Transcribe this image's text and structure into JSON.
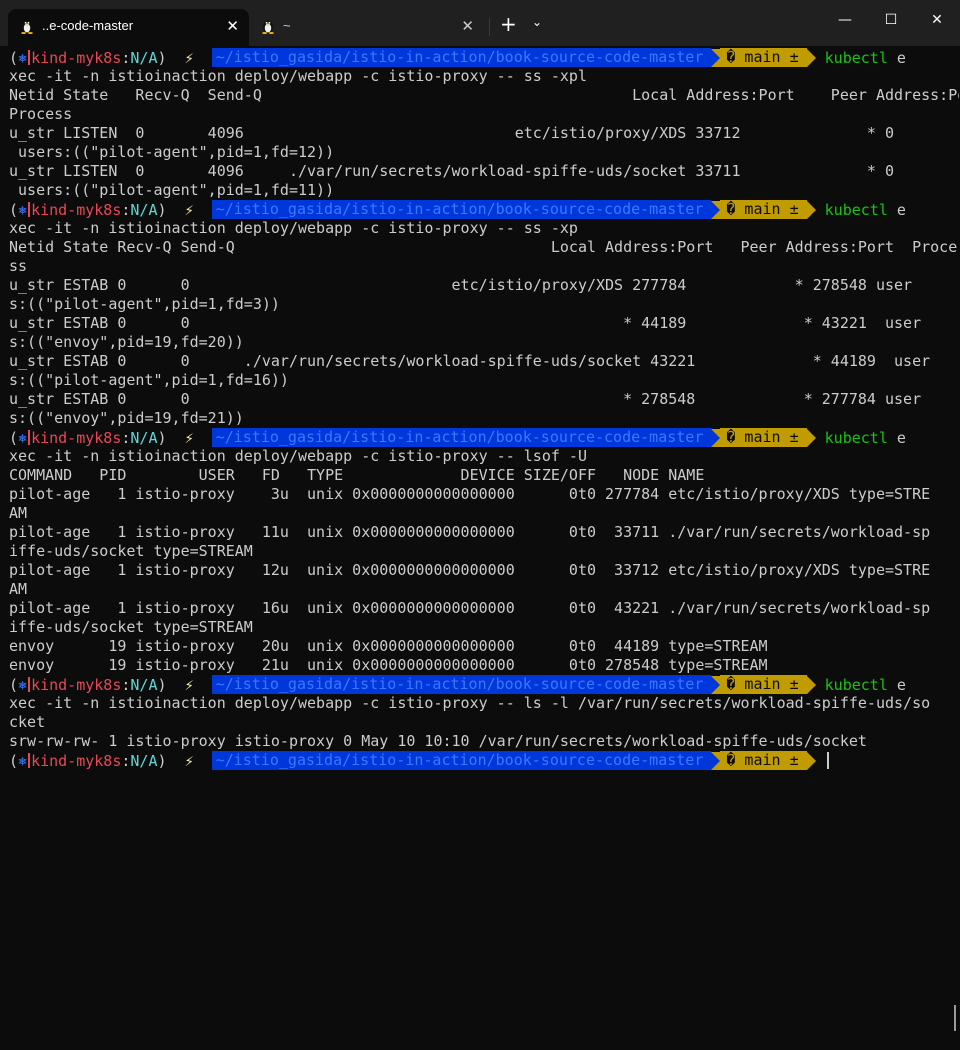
{
  "window": {
    "tabs": [
      {
        "title": "..e-code-master",
        "close": "✕"
      },
      {
        "title": "~",
        "close": "✕"
      }
    ],
    "new_tab": "+",
    "dropdown": "⌄",
    "minimize": "—",
    "maximize": "☐",
    "close": "✕"
  },
  "prompt": {
    "open_paren": "(",
    "k8s_icon": "⎈",
    "context": "kind-myk8s",
    "colon": ":",
    "namespace": "N/A",
    "close_paren": ")",
    "bolt": "⚡",
    "directory": "~/istio_gasida/istio-in-action/book-source-code-master",
    "git": "� main ±",
    "cmd_word": "kubectl"
  },
  "blocks": [
    {
      "cmd_rest": " e",
      "output": [
        "xec -it -n istioinaction deploy/webapp -c istio-proxy -- ss -xpl",
        "Netid State   Recv-Q  Send-Q                                         Local Address:Port    Peer Address:Port",
        "Process",
        "u_str LISTEN  0       4096                              etc/istio/proxy/XDS 33712              * 0",
        " users:((\"pilot-agent\",pid=1,fd=12))",
        "u_str LISTEN  0       4096     ./var/run/secrets/workload-spiffe-uds/socket 33711              * 0",
        " users:((\"pilot-agent\",pid=1,fd=11))"
      ]
    },
    {
      "cmd_rest": " e",
      "output": [
        "xec -it -n istioinaction deploy/webapp -c istio-proxy -- ss -xp",
        "Netid State Recv-Q Send-Q                                   Local Address:Port   Peer Address:Port  Proce",
        "ss",
        "u_str ESTAB 0      0                             etc/istio/proxy/XDS 277784            * 278548 user",
        "s:((\"pilot-agent\",pid=1,fd=3))",
        "u_str ESTAB 0      0                                                * 44189             * 43221  user",
        "s:((\"envoy\",pid=19,fd=20))",
        "u_str ESTAB 0      0      ./var/run/secrets/workload-spiffe-uds/socket 43221             * 44189  user",
        "s:((\"pilot-agent\",pid=1,fd=16))",
        "u_str ESTAB 0      0                                                * 278548            * 277784 user",
        "s:((\"envoy\",pid=19,fd=21))"
      ]
    },
    {
      "cmd_rest": " e",
      "output": [
        "xec -it -n istioinaction deploy/webapp -c istio-proxy -- lsof -U",
        "COMMAND   PID        USER   FD   TYPE             DEVICE SIZE/OFF   NODE NAME",
        "pilot-age   1 istio-proxy    3u  unix 0x0000000000000000      0t0 277784 etc/istio/proxy/XDS type=STRE",
        "AM",
        "pilot-age   1 istio-proxy   11u  unix 0x0000000000000000      0t0  33711 ./var/run/secrets/workload-sp",
        "iffe-uds/socket type=STREAM",
        "pilot-age   1 istio-proxy   12u  unix 0x0000000000000000      0t0  33712 etc/istio/proxy/XDS type=STRE",
        "AM",
        "pilot-age   1 istio-proxy   16u  unix 0x0000000000000000      0t0  43221 ./var/run/secrets/workload-sp",
        "iffe-uds/socket type=STREAM",
        "envoy      19 istio-proxy   20u  unix 0x0000000000000000      0t0  44189 type=STREAM",
        "envoy      19 istio-proxy   21u  unix 0x0000000000000000      0t0 278548 type=STREAM"
      ]
    },
    {
      "cmd_rest": " e",
      "output": [
        "xec -it -n istioinaction deploy/webapp -c istio-proxy -- ls -l /var/run/secrets/workload-spiffe-uds/so",
        "cket",
        "srw-rw-rw- 1 istio-proxy istio-proxy 0 May 10 10:10 /var/run/secrets/workload-spiffe-uds/socket"
      ]
    }
  ]
}
